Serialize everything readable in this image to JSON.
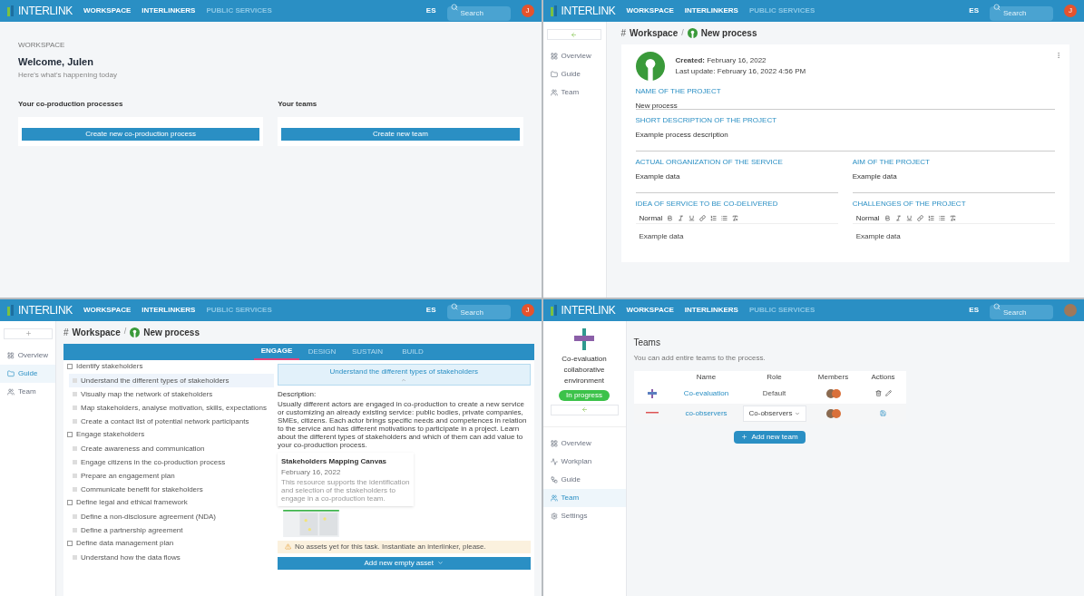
{
  "panels": [
    {
      "kind": "dashboard",
      "nav": {
        "logo": "INTERLINK",
        "links": [
          {
            "label": "WORKSPACE",
            "disabled": false
          },
          {
            "label": "INTERLINKERS",
            "disabled": false
          },
          {
            "label": "PUBLIC SERVICES",
            "disabled": true
          }
        ],
        "language": "ES",
        "search": {
          "placeholder": "Search"
        },
        "avatar": "J"
      },
      "kicker": "WORKSPACE",
      "title": "Welcome, Julen",
      "subtitle": "Here's what's happening today",
      "sections": [
        {
          "title": "Your co-production processes",
          "button": "Create new co-production process"
        },
        {
          "title": "Your teams",
          "button": "Create new team"
        }
      ]
    },
    {
      "kind": "project",
      "nav": {
        "logo": "INTERLINK",
        "links": [
          {
            "label": "WORKSPACE",
            "disabled": false
          },
          {
            "label": "INTERLINKERS",
            "disabled": false
          },
          {
            "label": "PUBLIC SERVICES",
            "disabled": true
          }
        ],
        "language": "ES",
        "search": {
          "placeholder": "Search"
        },
        "avatar": "J"
      },
      "sidebar": [
        {
          "label": "Overview",
          "selected": false
        },
        {
          "label": "Guide",
          "selected": false
        },
        {
          "label": "Team",
          "selected": false
        }
      ],
      "breadcrumb": {
        "icon": "#",
        "items": [
          "Workspace",
          "New process"
        ],
        "separator": "/"
      },
      "created_label": "Created:",
      "created": "February 16, 2022",
      "last_update": "Last update: February 16, 2022 4:56 PM",
      "fields": [
        {
          "kind": "text",
          "label": "NAME OF THE PROJECT",
          "value": "New process",
          "wide": true
        },
        {
          "kind": "area",
          "label": "SHORT DESCRIPTION OF THE PROJECT",
          "value": "Example process description",
          "wide": true
        },
        {
          "kind": "area",
          "label": "ACTUAL ORGANIZATION OF THE SERVICE",
          "value": "Example data",
          "wide": false
        },
        {
          "kind": "area",
          "label": "AIM OF THE PROJECT",
          "value": "Example data",
          "wide": false
        },
        {
          "kind": "editor",
          "label": "IDEA OF SERVICE TO BE CO-DELIVERED",
          "value": "Example data",
          "wide": false,
          "style": "Normal"
        },
        {
          "kind": "editor",
          "label": "CHALLENGES OF THE PROJECT",
          "value": "Example data",
          "wide": false,
          "style": "Normal"
        }
      ]
    },
    {
      "kind": "guide",
      "nav": {
        "logo": "INTERLINK",
        "links": [
          {
            "label": "WORKSPACE",
            "disabled": false
          },
          {
            "label": "INTERLINKERS",
            "disabled": false
          },
          {
            "label": "PUBLIC SERVICES",
            "disabled": true
          }
        ],
        "language": "ES",
        "search": {
          "placeholder": "Search"
        },
        "avatar": "J"
      },
      "sidebar": [
        {
          "label": "Overview",
          "selected": false
        },
        {
          "label": "Guide",
          "selected": true
        },
        {
          "label": "Team",
          "selected": false
        }
      ],
      "breadcrumb": {
        "icon": "#",
        "items": [
          "Workspace",
          "New process"
        ],
        "separator": "/"
      },
      "tabs": [
        {
          "label": "ENGAGE",
          "selected": true
        },
        {
          "label": "DESIGN",
          "selected": false
        },
        {
          "label": "SUSTAIN",
          "selected": false
        },
        {
          "label": "BUILD",
          "selected": false
        }
      ],
      "tree": [
        {
          "label": "Identify stakeholders",
          "selected": false,
          "children": [
            {
              "label": "Understand the different types of stakeholders",
              "selected": true
            },
            {
              "label": "Visually map the network of stakeholders",
              "selected": false
            },
            {
              "label": "Map stakeholders, analyse motivation, skills, expectations",
              "selected": false
            },
            {
              "label": "Create a contact list of potential network participants",
              "selected": false
            }
          ]
        },
        {
          "label": "Engage stakeholders",
          "selected": false,
          "children": [
            {
              "label": "Create awareness and communication",
              "selected": false
            },
            {
              "label": "Engage citizens in the co-production process",
              "selected": false
            },
            {
              "label": "Prepare an engagement plan",
              "selected": false
            },
            {
              "label": "Communicate benefit for stakeholders",
              "selected": false
            }
          ]
        },
        {
          "label": "Define legal and ethical framework",
          "selected": false,
          "children": [
            {
              "label": "Define a non-disclosure agreement (NDA)",
              "selected": false
            },
            {
              "label": "Define a partnership agreement",
              "selected": false
            }
          ]
        },
        {
          "label": "Define data management plan",
          "selected": false,
          "children": [
            {
              "label": "Understand how the data flows",
              "selected": false
            }
          ]
        }
      ],
      "task_title": "Understand the different types of stakeholders",
      "description_label": "Description:",
      "description": "Usually different actors are engaged in co-production to create a new service or customizing an already existing service: public bodies, private companies, SMEs, citizens. Each actor brings specific needs and competences in relation to the service and has different motivations to participate in a project. Learn about the different types of stakeholders and which of them can add value to your co-production process.",
      "resource": {
        "title": "Stakeholders Mapping Canvas",
        "date": "February 16, 2022",
        "text": "This resource supports the identification and selection of the stakeholders to engage in a co-production team."
      },
      "warning": "No assets yet for this task. Instantiate an interlinker, please.",
      "add_button": "Add new empty asset"
    },
    {
      "kind": "teams",
      "nav": {
        "logo": "INTERLINK",
        "links": [
          {
            "label": "WORKSPACE",
            "disabled": false
          },
          {
            "label": "INTERLINKERS",
            "disabled": false
          },
          {
            "label": "PUBLIC SERVICES",
            "disabled": true
          }
        ],
        "language": "ES",
        "search": {
          "placeholder": "Search"
        }
      },
      "process_name": "Co-evaluation collaborative environment",
      "status": "In progress",
      "sidebar": [
        {
          "label": "Overview",
          "selected": false
        },
        {
          "label": "Workplan",
          "selected": false
        },
        {
          "label": "Guide",
          "selected": false
        },
        {
          "label": "Team",
          "selected": true
        },
        {
          "label": "Settings",
          "selected": false
        }
      ],
      "title": "Teams",
      "subtitle": "You can add entire teams to the process.",
      "columns": [
        "Name",
        "Role",
        "Members",
        "Actions"
      ],
      "rows": [
        {
          "name": "Co-evaluation",
          "kind": "text",
          "role": "Default"
        },
        {
          "name": "co-observers",
          "kind": "select",
          "role": "Co-observers"
        }
      ],
      "add_button": "Add new team"
    }
  ]
}
